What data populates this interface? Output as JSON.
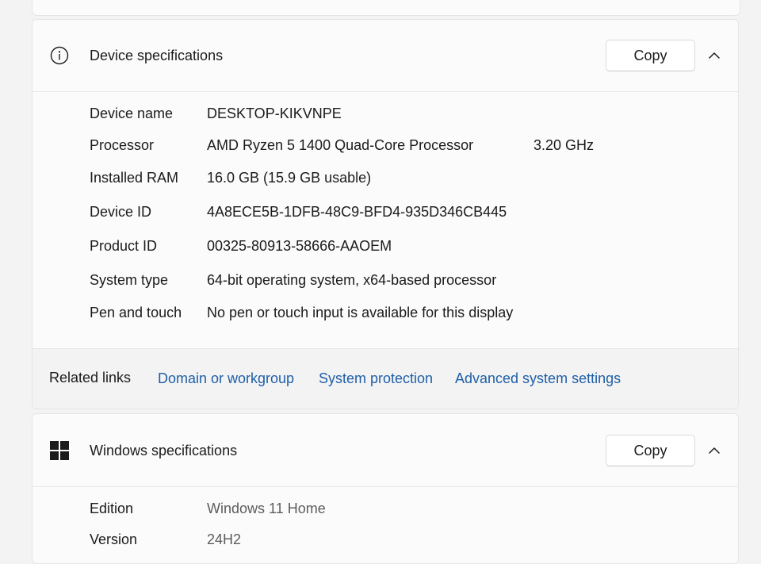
{
  "device_specifications": {
    "title": "Device specifications",
    "icon": "info-icon",
    "copy_label": "Copy",
    "rows": [
      {
        "label": "Device name",
        "value": "DESKTOP-KIKVNPE",
        "extra": ""
      },
      {
        "label": "Processor",
        "value": "AMD Ryzen 5 1400 Quad-Core Processor",
        "extra": "3.20 GHz"
      },
      {
        "label": "Installed RAM",
        "value": "16.0 GB (15.9 GB usable)",
        "extra": ""
      },
      {
        "label": "Device ID",
        "value": "4A8ECE5B-1DFB-48C9-BFD4-935D346CB445",
        "extra": ""
      },
      {
        "label": "Product ID",
        "value": "00325-80913-58666-AAOEM",
        "extra": ""
      },
      {
        "label": "System type",
        "value": "64-bit operating system, x64-based processor",
        "extra": ""
      },
      {
        "label": "Pen and touch",
        "value": "No pen or touch input is available for this display",
        "extra": ""
      }
    ]
  },
  "related_links": {
    "title": "Related links",
    "links": [
      "Domain or workgroup",
      "System protection",
      "Advanced system settings"
    ]
  },
  "windows_specifications": {
    "title": "Windows specifications",
    "icon": "windows-logo-icon",
    "copy_label": "Copy",
    "rows": [
      {
        "label": "Edition",
        "value": "Windows 11 Home"
      },
      {
        "label": "Version",
        "value": "24H2"
      }
    ]
  },
  "colors": {
    "link": "#1f5fa8",
    "background": "#f3f3f3",
    "card": "#fbfbfb"
  }
}
